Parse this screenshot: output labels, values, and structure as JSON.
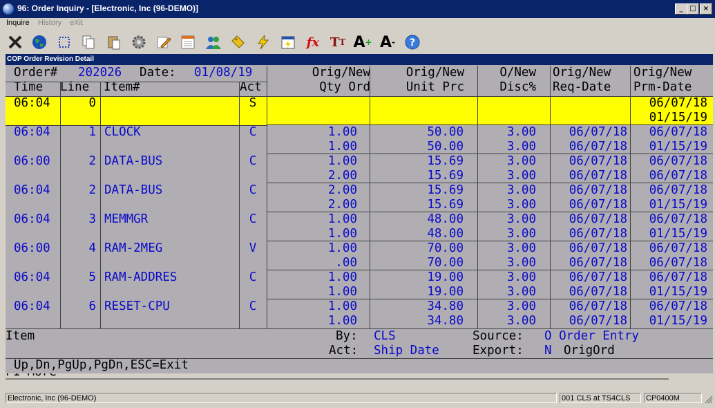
{
  "window": {
    "title": "96: Order Inquiry - [Electronic, Inc (96-DEMO)]",
    "btn_min": "_",
    "btn_max": "□",
    "btn_close": "×"
  },
  "menu": {
    "inquire": "Inquire",
    "history": "History",
    "exit": "eXit"
  },
  "panel": {
    "title": "COP Order Revision Detail"
  },
  "order": {
    "label": "Order#",
    "number": "202026",
    "date_label": "Date:",
    "date": "01/08/19"
  },
  "columns": {
    "time": "Time",
    "line": "Line",
    "item": "Item#",
    "act": "Act",
    "qty_top": "Orig/New",
    "qty_bottom": "Qty Ord",
    "prc_top": "Orig/New",
    "prc_bottom": "Unit Prc",
    "disc_top": "O/New",
    "disc_bottom": "Disc%",
    "req_top": "Orig/New",
    "req_bottom": "Req-Date",
    "prm_top": "Orig/New",
    "prm_bottom": "Prm-Date"
  },
  "rows": [
    {
      "time": "06:04",
      "line": "0",
      "item": "",
      "act": "S",
      "qty1": "",
      "qty2": "",
      "prc1": "",
      "prc2": "",
      "disc1": "",
      "disc2": "",
      "req1": "",
      "req2": "",
      "prm1": "06/07/18",
      "prm2": "01/15/19"
    },
    {
      "time": "06:04",
      "line": "1",
      "item": "CLOCK",
      "act": "C",
      "qty1": "1.00",
      "qty2": "1.00",
      "prc1": "50.00",
      "prc2": "50.00",
      "disc1": "3.00",
      "disc2": "3.00",
      "req1": "06/07/18",
      "req2": "06/07/18",
      "prm1": "06/07/18",
      "prm2": "01/15/19"
    },
    {
      "time": "06:00",
      "line": "2",
      "item": "DATA-BUS",
      "act": "C",
      "qty1": "1.00",
      "qty2": "2.00",
      "prc1": "15.69",
      "prc2": "15.69",
      "disc1": "3.00",
      "disc2": "3.00",
      "req1": "06/07/18",
      "req2": "06/07/18",
      "prm1": "06/07/18",
      "prm2": "06/07/18"
    },
    {
      "time": "06:04",
      "line": "2",
      "item": "DATA-BUS",
      "act": "C",
      "qty1": "2.00",
      "qty2": "2.00",
      "prc1": "15.69",
      "prc2": "15.69",
      "disc1": "3.00",
      "disc2": "3.00",
      "req1": "06/07/18",
      "req2": "06/07/18",
      "prm1": "06/07/18",
      "prm2": "01/15/19"
    },
    {
      "time": "06:04",
      "line": "3",
      "item": "MEMMGR",
      "act": "C",
      "qty1": "1.00",
      "qty2": "1.00",
      "prc1": "48.00",
      "prc2": "48.00",
      "disc1": "3.00",
      "disc2": "3.00",
      "req1": "06/07/18",
      "req2": "06/07/18",
      "prm1": "06/07/18",
      "prm2": "01/15/19"
    },
    {
      "time": "06:00",
      "line": "4",
      "item": "RAM-2MEG",
      "act": "V",
      "qty1": "1.00",
      "qty2": ".00",
      "prc1": "70.00",
      "prc2": "70.00",
      "disc1": "3.00",
      "disc2": "3.00",
      "req1": "06/07/18",
      "req2": "06/07/18",
      "prm1": "06/07/18",
      "prm2": "06/07/18"
    },
    {
      "time": "06:04",
      "line": "5",
      "item": "RAM-ADDRES",
      "act": "C",
      "qty1": "1.00",
      "qty2": "1.00",
      "prc1": "19.00",
      "prc2": "19.00",
      "disc1": "3.00",
      "disc2": "3.00",
      "req1": "06/07/18",
      "req2": "06/07/18",
      "prm1": "06/07/18",
      "prm2": "01/15/19"
    },
    {
      "time": "06:04",
      "line": "6",
      "item": "RESET-CPU",
      "act": "C",
      "qty1": "1.00",
      "qty2": "1.00",
      "prc1": "34.80",
      "prc2": "34.80",
      "disc1": "3.00",
      "disc2": "3.00",
      "req1": "06/07/18",
      "req2": "06/07/18",
      "prm1": "06/07/18",
      "prm2": "01/15/19"
    }
  ],
  "footer": {
    "item_label": "Item",
    "by_label": "By:",
    "by_value": "CLS",
    "source_label": "Source:",
    "source_value": "O Order Entry",
    "act_label": "Act:",
    "act_value": "Ship Date",
    "export_label": "Export:",
    "export_flag": "N",
    "export_value": "OrigOrd",
    "keys": "Up,Dn,PgUp,PgDn,ESC=Exit",
    "behind_text": "F1-More"
  },
  "statusbar": {
    "company": "Electronic, Inc (96-DEMO)",
    "user": "001 CLS at TS4CLS",
    "program": "CP0400M"
  },
  "toolbar_icons": [
    "close-x",
    "globe",
    "select-box",
    "copy",
    "paste",
    "settings-gear",
    "edit-pencil",
    "notepad",
    "users",
    "tags",
    "lightning",
    "calendar-run",
    "fx",
    "text-size",
    "font-increase",
    "font-decrease",
    "help"
  ],
  "colors": {
    "title_bg": "#0a246a",
    "highlight_row": "#ffff00",
    "data_text": "#0a0ac8",
    "panel_bg": "#b0aeb3"
  }
}
